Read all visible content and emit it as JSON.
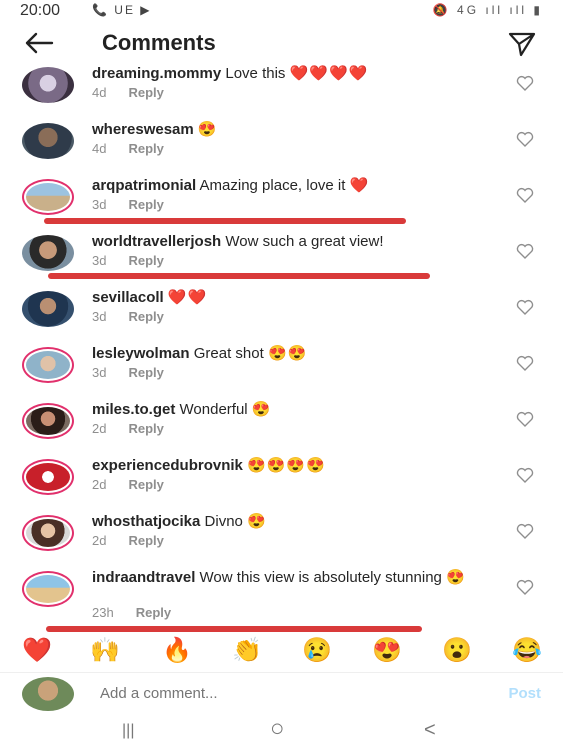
{
  "status": {
    "time": "20:00",
    "left_icons": "📞 UE ▶",
    "right_icons": "🔕 4G ıll ıll ▮"
  },
  "header": {
    "title": "Comments"
  },
  "comments": [
    {
      "username": "dreaming.mommy",
      "text": "Love this",
      "emoji": "❤️❤️❤️❤️",
      "time": "4d",
      "reply": "Reply"
    },
    {
      "username": "whereswesam",
      "text": "",
      "emoji": "😍",
      "time": "4d",
      "reply": "Reply"
    },
    {
      "username": "arqpatrimonial",
      "text": "Amazing place, love it",
      "emoji": "❤️",
      "time": "3d",
      "reply": "Reply"
    },
    {
      "username": "worldtravellerjosh",
      "text": "Wow such a great view!",
      "emoji": "",
      "time": "3d",
      "reply": "Reply"
    },
    {
      "username": "sevillacoll",
      "text": "",
      "emoji": "❤️❤️",
      "time": "3d",
      "reply": "Reply"
    },
    {
      "username": "lesleywolman",
      "text": "Great shot",
      "emoji": "😍😍",
      "time": "3d",
      "reply": "Reply"
    },
    {
      "username": "miles.to.get",
      "text": "Wonderful",
      "emoji": "😍",
      "time": "2d",
      "reply": "Reply"
    },
    {
      "username": "experiencedubrovnik",
      "text": "",
      "emoji": "😍😍😍😍",
      "time": "2d",
      "reply": "Reply"
    },
    {
      "username": "whosthatjocika",
      "text": "Divno",
      "emoji": "😍",
      "time": "2d",
      "reply": "Reply"
    },
    {
      "username": "indraandtravel",
      "text": "Wow this  view is absolutely stunning",
      "emoji": "😍",
      "time": "23h",
      "reply": "Reply"
    }
  ],
  "emoji_bar": [
    "❤️",
    "🙌",
    "🔥",
    "👏",
    "😢",
    "😍",
    "😮",
    "😂"
  ],
  "add_comment": {
    "placeholder": "Add a comment...",
    "post": "Post"
  },
  "nav": {
    "recent": "|||",
    "home": "○",
    "back": "<"
  },
  "colors": {
    "underline": "#d93a3a",
    "story_ring": "#e1306c",
    "post_disabled": "#b2dffc"
  }
}
